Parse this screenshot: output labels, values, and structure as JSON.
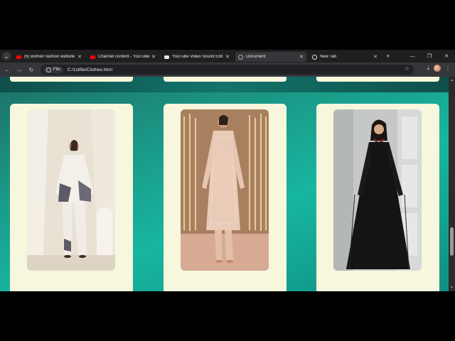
{
  "browser": {
    "tabs": [
      {
        "label": "(6) women fashion website p",
        "favicon": "youtube-icon",
        "active": false
      },
      {
        "label": "Channel content - YouTube S",
        "favicon": "youtube-icon",
        "active": false
      },
      {
        "label": "YouTube Video Sound Edit",
        "favicon": "youtube-studio-icon",
        "active": false
      },
      {
        "label": "Document",
        "favicon": "document-icon",
        "active": true
      },
      {
        "label": "New Tab",
        "favicon": "globe-icon",
        "active": false
      }
    ],
    "tab_close": "✕",
    "new_tab": "+",
    "window_controls": {
      "minimize": "—",
      "restore": "❐",
      "close": "✕"
    },
    "nav": {
      "back": "←",
      "forward": "→",
      "reload": "↻"
    },
    "omnibox": {
      "info_label": "File",
      "url": "C:/1stfile/Clothes.html"
    },
    "star": "☆",
    "download": "⤓",
    "menu": "⋮"
  },
  "colors": {
    "card_bg": "#f6f7dc",
    "page_gradient_start": "#1e6f67",
    "page_gradient_mid": "#17b6a0",
    "tabbar_bg": "#1f1f1f",
    "toolbar_bg": "#35363a"
  },
  "products": [
    {
      "name": "product-white-printed-kurta",
      "description": "white printed kurta with trousers"
    },
    {
      "name": "product-pink-embroidered-suit",
      "description": "pink embroidered suit"
    },
    {
      "name": "product-black-anarkali",
      "description": "black anarkali dress"
    }
  ]
}
